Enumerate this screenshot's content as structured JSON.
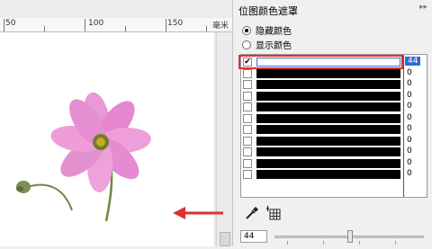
{
  "ruler": {
    "labels": [
      "50",
      "100",
      "150"
    ],
    "unit": "毫米"
  },
  "panel": {
    "title": "位图颜色遮罩",
    "radio_hide": "隐藏颜色",
    "radio_show": "显示颜色",
    "selected_mode": "hide"
  },
  "color_list": {
    "rows": [
      {
        "checked": true,
        "color": "#ffffff",
        "tolerance": "44",
        "selected": true
      },
      {
        "checked": false,
        "color": "#000000",
        "tolerance": "0",
        "selected": false
      },
      {
        "checked": false,
        "color": "#000000",
        "tolerance": "0",
        "selected": false
      },
      {
        "checked": false,
        "color": "#000000",
        "tolerance": "0",
        "selected": false
      },
      {
        "checked": false,
        "color": "#000000",
        "tolerance": "0",
        "selected": false
      },
      {
        "checked": false,
        "color": "#000000",
        "tolerance": "0",
        "selected": false
      },
      {
        "checked": false,
        "color": "#000000",
        "tolerance": "0",
        "selected": false
      },
      {
        "checked": false,
        "color": "#000000",
        "tolerance": "0",
        "selected": false
      },
      {
        "checked": false,
        "color": "#000000",
        "tolerance": "0",
        "selected": false
      },
      {
        "checked": false,
        "color": "#000000",
        "tolerance": "0",
        "selected": false
      },
      {
        "checked": false,
        "color": "#000000",
        "tolerance": "0",
        "selected": false
      }
    ]
  },
  "tolerance": {
    "value": "44",
    "slider_fraction": 0.44
  },
  "icons": {
    "eyedropper": "eyedropper-icon",
    "edit_color": "edit-color-icon",
    "arrow": "arrow-left-icon"
  },
  "colors": {
    "selection_outline": "#e0302c",
    "arrow": "#e0302c",
    "selected_badge": "#2f6ad6"
  }
}
